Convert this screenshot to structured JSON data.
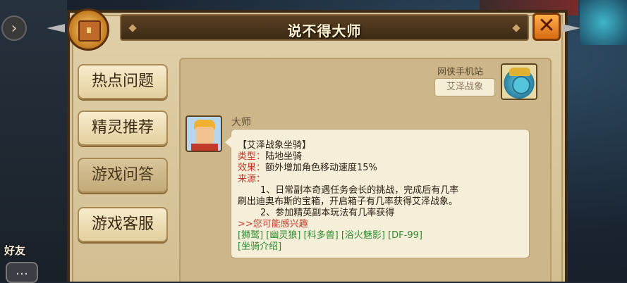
{
  "window": {
    "title": "说不得大师",
    "close_label": "✕"
  },
  "sidebar": {
    "items": [
      {
        "label": "热点问题"
      },
      {
        "label": "精灵推荐"
      },
      {
        "label": "游戏问答"
      },
      {
        "label": "游戏客服"
      }
    ]
  },
  "background": {
    "friend_label": "好友"
  },
  "user_message": {
    "name": "网侠手机站",
    "text": "艾泽战象"
  },
  "master_message": {
    "name": "大师",
    "heading": "【艾泽战象坐骑】",
    "type_label": "类型：",
    "type_value": "陆地坐骑",
    "effect_label": "效果：",
    "effect_value": "额外增加角色移动速度15%",
    "source_label": "来源：",
    "source_1a": "1、日常副本奇遇任务会长的挑战，完成后有几率",
    "source_1b": "刷出迪奥布斯的宝箱，开启箱子有几率获得艾泽战象。",
    "source_2": "2、参加精英副本玩法有几率获得",
    "interest_label": ">>您可能感兴趣",
    "links_row1": "[狮鹫] [幽灵狼] [科多兽] [浴火魅影] [DF-99]",
    "links_row2": "[坐骑介绍]"
  },
  "colors": {
    "accent_red": "#c0392b",
    "link_green": "#2e8b2e"
  }
}
